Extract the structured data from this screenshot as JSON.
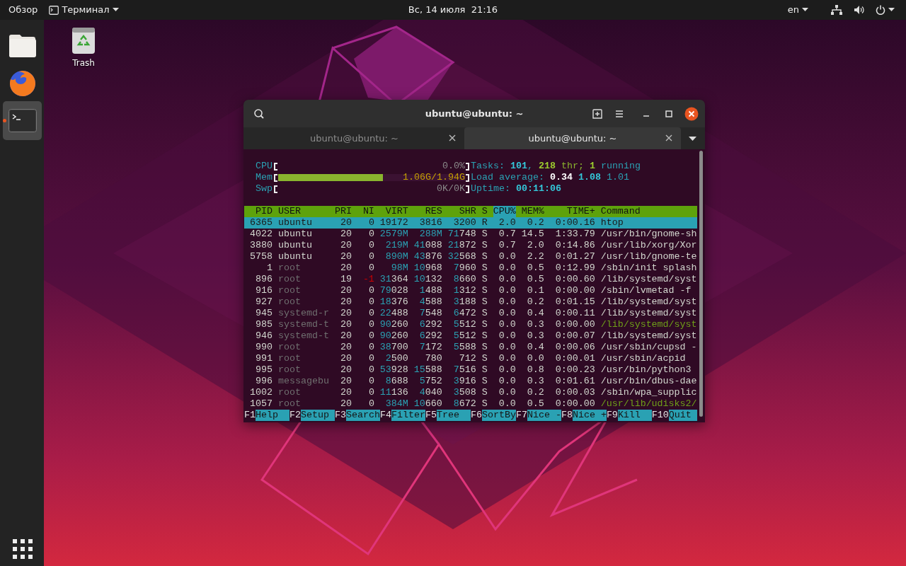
{
  "top_bar": {
    "activities": "Обзор",
    "app_menu": "Терминал",
    "clock": "Вс, 14 июля  21:16",
    "language": "en"
  },
  "dock": {
    "items": [
      {
        "kind": "files",
        "running": false,
        "selected": false
      },
      {
        "kind": "browser",
        "running": false,
        "selected": false
      },
      {
        "kind": "terminal",
        "running": true,
        "selected": true
      },
      {
        "kind": "apps",
        "running": false,
        "selected": false
      }
    ]
  },
  "desktop_icons": [
    {
      "label": "Trash"
    }
  ],
  "terminal": {
    "title": "ubuntu@ubuntu: ~",
    "tabs": [
      {
        "label": "ubuntu@ubuntu: ~",
        "selected": false
      },
      {
        "label": "ubuntu@ubuntu: ~",
        "selected": true
      }
    ],
    "htop": {
      "meters": [
        {
          "kind": "cpu",
          "label": "CPU",
          "reading": "0.0%"
        },
        {
          "kind": "mem",
          "label": "Mem",
          "reading": "1.06G/1.94G",
          "level": 0.56
        },
        {
          "kind": "swap",
          "label": "Swp",
          "reading": "0K/0K"
        }
      ],
      "status_lines": [
        {
          "parts": [
            {
              "text": "Tasks: ",
              "kind": "label"
            },
            {
              "text": "101",
              "kind": "value"
            },
            {
              "text": ", ",
              "kind": "label"
            },
            {
              "text": "218",
              "kind": "threadvalue"
            },
            {
              "text": " thr; ",
              "kind": "thread"
            },
            {
              "text": "1",
              "kind": "threadvalue"
            },
            {
              "text": " running",
              "kind": "label"
            }
          ]
        },
        {
          "parts": [
            {
              "text": "Load average: ",
              "kind": "label"
            },
            {
              "text": "0.34 ",
              "kind": "bright"
            },
            {
              "text": "1.08 ",
              "kind": "value"
            },
            {
              "text": "1.01",
              "kind": "label"
            }
          ]
        },
        {
          "parts": [
            {
              "text": "Uptime: ",
              "kind": "label"
            },
            {
              "text": "00:11:06",
              "kind": "value"
            }
          ]
        }
      ],
      "columns": [
        {
          "label": "PID",
          "sorted": false
        },
        {
          "label": "USER",
          "sorted": false
        },
        {
          "label": "PRI",
          "sorted": false
        },
        {
          "label": "NI",
          "sorted": false
        },
        {
          "label": "VIRT",
          "sorted": false
        },
        {
          "label": "RES",
          "sorted": false
        },
        {
          "label": "SHR",
          "sorted": false
        },
        {
          "label": "S",
          "sorted": false
        },
        {
          "label": "CPU%",
          "sorted": true
        },
        {
          "label": "MEM%",
          "sorted": false
        },
        {
          "label": "TIME+",
          "sorted": false
        },
        {
          "label": "Command",
          "sorted": false
        }
      ],
      "rows": [
        {
          "pid": "6365",
          "user": "ubuntu",
          "pri": "20",
          "ni": "0",
          "virt": "19172",
          "res": "3816",
          "shr": "3200",
          "state": "R",
          "cpu": "2.0",
          "mem": "0.2",
          "time": "0:00.16",
          "command": "htop",
          "selected": true
        },
        {
          "pid": "4022",
          "user": "ubuntu",
          "pri": "20",
          "ni": "0",
          "virt": "2579M",
          "res": "288M",
          "shr": "71748",
          "state": "S",
          "cpu": "0.7",
          "mem": "14.5",
          "time": "1:33.79",
          "command": "/usr/bin/gnome-sh",
          "selected": false,
          "current_user": true,
          "thread": false,
          "niced": false
        },
        {
          "pid": "3880",
          "user": "ubuntu",
          "pri": "20",
          "ni": "0",
          "virt": "219M",
          "res": "41088",
          "shr": "21872",
          "state": "S",
          "cpu": "0.7",
          "mem": "2.0",
          "time": "0:14.86",
          "command": "/usr/lib/xorg/Xor",
          "selected": false,
          "current_user": true,
          "thread": false,
          "niced": false
        },
        {
          "pid": "5758",
          "user": "ubuntu",
          "pri": "20",
          "ni": "0",
          "virt": "890M",
          "res": "43876",
          "shr": "32568",
          "state": "S",
          "cpu": "0.0",
          "mem": "2.2",
          "time": "0:01.27",
          "command": "/usr/lib/gnome-te",
          "selected": false,
          "current_user": true,
          "thread": false,
          "niced": false
        },
        {
          "pid": "1",
          "user": "root",
          "pri": "20",
          "ni": "0",
          "virt": "98M",
          "res": "10968",
          "shr": "7960",
          "state": "S",
          "cpu": "0.0",
          "mem": "0.5",
          "time": "0:12.99",
          "command": "/sbin/init splash",
          "selected": false,
          "current_user": false,
          "thread": false,
          "niced": false
        },
        {
          "pid": "896",
          "user": "root",
          "pri": "19",
          "ni": "-1",
          "virt": "31364",
          "res": "10132",
          "shr": "8660",
          "state": "S",
          "cpu": "0.0",
          "mem": "0.5",
          "time": "0:00.60",
          "command": "/lib/systemd/syst",
          "selected": false,
          "current_user": false,
          "thread": false,
          "niced": true
        },
        {
          "pid": "916",
          "user": "root",
          "pri": "20",
          "ni": "0",
          "virt": "79028",
          "res": "1488",
          "shr": "1312",
          "state": "S",
          "cpu": "0.0",
          "mem": "0.1",
          "time": "0:00.00",
          "command": "/sbin/lvmetad -f",
          "selected": false,
          "current_user": false,
          "thread": false,
          "niced": false
        },
        {
          "pid": "927",
          "user": "root",
          "pri": "20",
          "ni": "0",
          "virt": "18376",
          "res": "4588",
          "shr": "3188",
          "state": "S",
          "cpu": "0.0",
          "mem": "0.2",
          "time": "0:01.15",
          "command": "/lib/systemd/syst",
          "selected": false,
          "current_user": false,
          "thread": false,
          "niced": false
        },
        {
          "pid": "945",
          "user": "systemd-r",
          "pri": "20",
          "ni": "0",
          "virt": "22488",
          "res": "7548",
          "shr": "6472",
          "state": "S",
          "cpu": "0.0",
          "mem": "0.4",
          "time": "0:00.11",
          "command": "/lib/systemd/syst",
          "selected": false,
          "current_user": false,
          "thread": false,
          "niced": false
        },
        {
          "pid": "985",
          "user": "systemd-t",
          "pri": "20",
          "ni": "0",
          "virt": "90260",
          "res": "6292",
          "shr": "5512",
          "state": "S",
          "cpu": "0.0",
          "mem": "0.3",
          "time": "0:00.00",
          "command": "/lib/systemd/syst",
          "selected": false,
          "current_user": false,
          "thread": true,
          "niced": false
        },
        {
          "pid": "946",
          "user": "systemd-t",
          "pri": "20",
          "ni": "0",
          "virt": "90260",
          "res": "6292",
          "shr": "5512",
          "state": "S",
          "cpu": "0.0",
          "mem": "0.3",
          "time": "0:00.07",
          "command": "/lib/systemd/syst",
          "selected": false,
          "current_user": false,
          "thread": false,
          "niced": false
        },
        {
          "pid": "990",
          "user": "root",
          "pri": "20",
          "ni": "0",
          "virt": "38700",
          "res": "7172",
          "shr": "5588",
          "state": "S",
          "cpu": "0.0",
          "mem": "0.4",
          "time": "0:00.06",
          "command": "/usr/sbin/cupsd -",
          "selected": false,
          "current_user": false,
          "thread": false,
          "niced": false
        },
        {
          "pid": "991",
          "user": "root",
          "pri": "20",
          "ni": "0",
          "virt": "2500",
          "res": "780",
          "shr": "712",
          "state": "S",
          "cpu": "0.0",
          "mem": "0.0",
          "time": "0:00.01",
          "command": "/usr/sbin/acpid",
          "selected": false,
          "current_user": false,
          "thread": false,
          "niced": false
        },
        {
          "pid": "995",
          "user": "root",
          "pri": "20",
          "ni": "0",
          "virt": "53928",
          "res": "15588",
          "shr": "7516",
          "state": "S",
          "cpu": "0.0",
          "mem": "0.8",
          "time": "0:00.23",
          "command": "/usr/bin/python3",
          "selected": false,
          "current_user": false,
          "thread": false,
          "niced": false
        },
        {
          "pid": "996",
          "user": "messagebu",
          "pri": "20",
          "ni": "0",
          "virt": "8688",
          "res": "5752",
          "shr": "3916",
          "state": "S",
          "cpu": "0.0",
          "mem": "0.3",
          "time": "0:01.61",
          "command": "/usr/bin/dbus-dae",
          "selected": false,
          "current_user": false,
          "thread": false,
          "niced": false
        },
        {
          "pid": "1002",
          "user": "root",
          "pri": "20",
          "ni": "0",
          "virt": "11136",
          "res": "4040",
          "shr": "3508",
          "state": "S",
          "cpu": "0.0",
          "mem": "0.2",
          "time": "0:00.03",
          "command": "/sbin/wpa_supplic",
          "selected": false,
          "current_user": false,
          "thread": false,
          "niced": false
        },
        {
          "pid": "1057",
          "user": "root",
          "pri": "20",
          "ni": "0",
          "virt": "384M",
          "res": "10660",
          "shr": "8672",
          "state": "S",
          "cpu": "0.0",
          "mem": "0.5",
          "time": "0:00.00",
          "command": "/usr/lib/udisks2/",
          "selected": false,
          "current_user": false,
          "thread": true,
          "niced": false
        }
      ],
      "function_keys": [
        {
          "key": "F1",
          "label": "Help"
        },
        {
          "key": "F2",
          "label": "Setup"
        },
        {
          "key": "F3",
          "label": "Search"
        },
        {
          "key": "F4",
          "label": "Filter"
        },
        {
          "key": "F5",
          "label": "Tree"
        },
        {
          "key": "F6",
          "label": "SortBy"
        },
        {
          "key": "F7",
          "label": "Nice -"
        },
        {
          "key": "F8",
          "label": "Nice +"
        },
        {
          "key": "F9",
          "label": "Kill"
        },
        {
          "key": "F10",
          "label": "Quit"
        }
      ]
    }
  }
}
